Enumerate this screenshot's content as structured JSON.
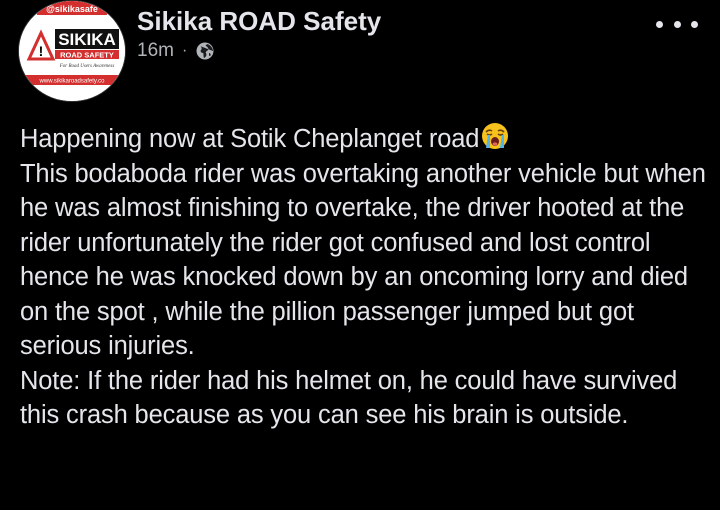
{
  "post": {
    "author": {
      "name": "Sikika ROAD Safety",
      "avatar": {
        "handle": "@sikikasafe",
        "brand": "SIKIKA",
        "subtitle": "ROAD SAFETY",
        "tagline": "For Road Users Awareness",
        "website": "www.sikikaroadsafety.co",
        "accent_color": "#d32f2f"
      }
    },
    "time": "16m",
    "separator": "·",
    "audience_icon": "globe-icon",
    "more_icon": "more-options-icon",
    "content": {
      "line1": "Happening now at Sotik Cheplanget road",
      "emoji": "loudly-crying-face-icon",
      "paragraph1": "This bodaboda rider was overtaking another vehicle but when he was almost finishing to overtake, the driver hooted at the rider unfortunately the rider got confused and lost control hence he was knocked down by an oncoming lorry and died on the spot , while the pillion passenger jumped but got serious injuries.",
      "paragraph2": "Note: If the rider had his helmet on, he could have survived this crash because as you can see his brain is outside."
    }
  }
}
